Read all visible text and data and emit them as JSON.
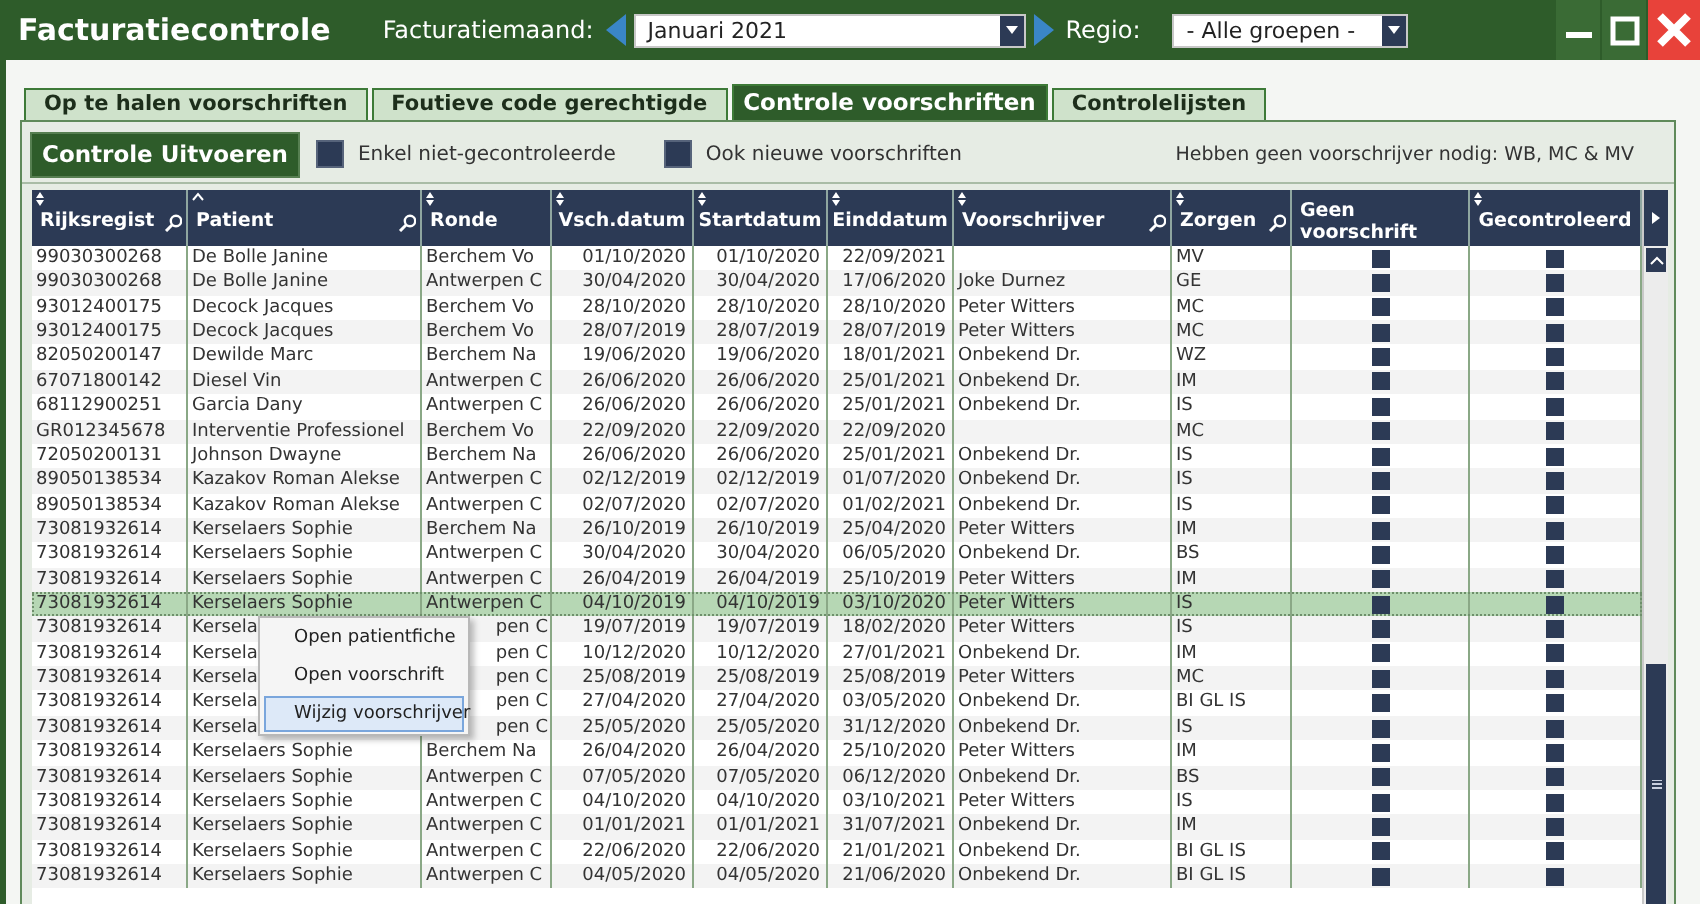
{
  "window": {
    "title": "Facturatiecontrole"
  },
  "filters": {
    "month_label": "Facturatiemaand:",
    "month": "Januari 2021",
    "region_label": "Regio:",
    "region": "- Alle groepen -"
  },
  "tabs": [
    {
      "label": "Op te halen voorschriften",
      "selected": false
    },
    {
      "label": "Foutieve code gerechtigde",
      "selected": false
    },
    {
      "label": "Controle voorschriften",
      "selected": true
    },
    {
      "label": "Controlelijsten",
      "selected": false
    }
  ],
  "toolbar": {
    "run_button": "Controle Uitvoeren",
    "options": [
      {
        "label": "Enkel niet-gecontroleerde",
        "checked": false
      },
      {
        "label": "Ook nieuwe voorschriften",
        "checked": false
      }
    ],
    "note": "Hebben geen voorschrijver nodig: WB, MC & MV"
  },
  "table": {
    "columns": [
      {
        "label": "Rijksregist",
        "kind": "text",
        "sortable": true,
        "sorted": false,
        "filter": true
      },
      {
        "label": "Patient",
        "kind": "text",
        "sortable": true,
        "sorted": true,
        "filter": true
      },
      {
        "label": "Ronde",
        "kind": "text",
        "sortable": true,
        "sorted": false,
        "filter": false
      },
      {
        "label": "Vsch.datum",
        "kind": "date",
        "sortable": true,
        "sorted": false,
        "filter": false
      },
      {
        "label": "Startdatum",
        "kind": "date",
        "sortable": true,
        "sorted": false,
        "filter": false
      },
      {
        "label": "Einddatum",
        "kind": "date",
        "sortable": true,
        "sorted": false,
        "filter": false
      },
      {
        "label": "Voorschrijver",
        "kind": "text",
        "sortable": true,
        "sorted": false,
        "filter": true
      },
      {
        "label": "Zorgen",
        "kind": "text",
        "sortable": true,
        "sorted": false,
        "filter": true
      },
      {
        "label": "Geen voorschrift",
        "kind": "check",
        "sortable": false,
        "filter": false
      },
      {
        "label": "Gecontroleerd",
        "kind": "check",
        "sortable": true,
        "sorted": false,
        "filter": false
      }
    ],
    "rows": [
      {
        "cells": [
          "99030300268",
          "De Bolle Janine",
          "Berchem Vo",
          "01/10/2020",
          "01/10/2020",
          "22/09/2021",
          null,
          "MV"
        ],
        "checks": [
          false,
          false
        ],
        "selected": false,
        "under_menu": false
      },
      {
        "cells": [
          "99030300268",
          "De Bolle Janine",
          "Antwerpen C",
          "30/04/2020",
          "30/04/2020",
          "17/06/2020",
          "Joke Durnez",
          "GE"
        ],
        "checks": [
          false,
          false
        ],
        "selected": false,
        "under_menu": false
      },
      {
        "cells": [
          "93012400175",
          "Decock Jacques",
          "Berchem Vo",
          "28/10/2020",
          "28/10/2020",
          "28/10/2020",
          "Peter Witters",
          "MC"
        ],
        "checks": [
          false,
          false
        ],
        "selected": false,
        "under_menu": false
      },
      {
        "cells": [
          "93012400175",
          "Decock Jacques",
          "Berchem Vo",
          "28/07/2019",
          "28/07/2019",
          "28/07/2019",
          "Peter Witters",
          "MC"
        ],
        "checks": [
          false,
          false
        ],
        "selected": false,
        "under_menu": false
      },
      {
        "cells": [
          "82050200147",
          "Dewilde Marc",
          "Berchem Na",
          "19/06/2020",
          "19/06/2020",
          "18/01/2021",
          "Onbekend Dr.",
          "WZ"
        ],
        "checks": [
          false,
          false
        ],
        "selected": false,
        "under_menu": false
      },
      {
        "cells": [
          "67071800142",
          "Diesel Vin",
          "Antwerpen C",
          "26/06/2020",
          "26/06/2020",
          "25/01/2021",
          "Onbekend Dr.",
          "IM"
        ],
        "checks": [
          false,
          false
        ],
        "selected": false,
        "under_menu": false
      },
      {
        "cells": [
          "68112900251",
          "Garcia Dany",
          "Antwerpen C",
          "26/06/2020",
          "26/06/2020",
          "25/01/2021",
          "Onbekend Dr.",
          "IS"
        ],
        "checks": [
          false,
          false
        ],
        "selected": false,
        "under_menu": false
      },
      {
        "cells": [
          "GR012345678",
          "Interventie Professionel",
          "Berchem Vo",
          "22/09/2020",
          "22/09/2020",
          "22/09/2020",
          null,
          "MC"
        ],
        "checks": [
          false,
          false
        ],
        "selected": false,
        "under_menu": false
      },
      {
        "cells": [
          "72050200131",
          "Johnson Dwayne",
          "Berchem Na",
          "26/06/2020",
          "26/06/2020",
          "25/01/2021",
          "Onbekend Dr.",
          "IS"
        ],
        "checks": [
          false,
          false
        ],
        "selected": false,
        "under_menu": false
      },
      {
        "cells": [
          "89050138534",
          "Kazakov Roman Alekse",
          "Antwerpen C",
          "02/12/2019",
          "02/12/2019",
          "01/07/2020",
          "Onbekend Dr.",
          "IS"
        ],
        "checks": [
          false,
          false
        ],
        "selected": false,
        "under_menu": false
      },
      {
        "cells": [
          "89050138534",
          "Kazakov Roman Alekse",
          "Antwerpen C",
          "02/07/2020",
          "02/07/2020",
          "01/02/2021",
          "Onbekend Dr.",
          "IS"
        ],
        "checks": [
          false,
          false
        ],
        "selected": false,
        "under_menu": false
      },
      {
        "cells": [
          "73081932614",
          "Kerselaers Sophie",
          "Berchem Na",
          "26/10/2019",
          "26/10/2019",
          "25/04/2020",
          "Peter Witters",
          "IM"
        ],
        "checks": [
          false,
          false
        ],
        "selected": false,
        "under_menu": false
      },
      {
        "cells": [
          "73081932614",
          "Kerselaers Sophie",
          "Antwerpen C",
          "30/04/2020",
          "30/04/2020",
          "06/05/2020",
          "Onbekend Dr.",
          "BS"
        ],
        "checks": [
          false,
          false
        ],
        "selected": false,
        "under_menu": false
      },
      {
        "cells": [
          "73081932614",
          "Kerselaers Sophie",
          "Antwerpen C",
          "26/04/2019",
          "26/04/2019",
          "25/10/2019",
          "Peter Witters",
          "IM"
        ],
        "checks": [
          false,
          false
        ],
        "selected": false,
        "under_menu": false
      },
      {
        "cells": [
          "73081932614",
          "Kerselaers Sophie",
          "Antwerpen C",
          "04/10/2019",
          "04/10/2019",
          "03/10/2020",
          "Peter Witters",
          "IS"
        ],
        "checks": [
          false,
          false
        ],
        "selected": true,
        "under_menu": false
      },
      {
        "cells": [
          "73081932614",
          "Kersela",
          "pen C",
          "19/07/2019",
          "19/07/2019",
          "18/02/2020",
          "Peter Witters",
          "IS"
        ],
        "checks": [
          false,
          false
        ],
        "selected": false,
        "under_menu": true
      },
      {
        "cells": [
          "73081932614",
          "Kersela",
          "pen C",
          "10/12/2020",
          "10/12/2020",
          "27/01/2021",
          "Onbekend Dr.",
          "IM"
        ],
        "checks": [
          false,
          false
        ],
        "selected": false,
        "under_menu": true
      },
      {
        "cells": [
          "73081932614",
          "Kersela",
          "pen C",
          "25/08/2019",
          "25/08/2019",
          "25/08/2019",
          "Peter Witters",
          "MC"
        ],
        "checks": [
          false,
          false
        ],
        "selected": false,
        "under_menu": true
      },
      {
        "cells": [
          "73081932614",
          "Kersela",
          "pen C",
          "27/04/2020",
          "27/04/2020",
          "03/05/2020",
          "Onbekend Dr.",
          "BI GL IS"
        ],
        "checks": [
          false,
          false
        ],
        "selected": false,
        "under_menu": true
      },
      {
        "cells": [
          "73081932614",
          "Kersela",
          "pen C",
          "25/05/2020",
          "25/05/2020",
          "31/12/2020",
          "Onbekend Dr.",
          "IS"
        ],
        "checks": [
          false,
          false
        ],
        "selected": false,
        "under_menu": true
      },
      {
        "cells": [
          "73081932614",
          "Kerselaers Sophie",
          "Berchem Na",
          "26/04/2020",
          "26/04/2020",
          "25/10/2020",
          "Peter Witters",
          "IM"
        ],
        "checks": [
          false,
          false
        ],
        "selected": false,
        "under_menu": false
      },
      {
        "cells": [
          "73081932614",
          "Kerselaers Sophie",
          "Antwerpen C",
          "07/05/2020",
          "07/05/2020",
          "06/12/2020",
          "Onbekend Dr.",
          "BS"
        ],
        "checks": [
          false,
          false
        ],
        "selected": false,
        "under_menu": false
      },
      {
        "cells": [
          "73081932614",
          "Kerselaers Sophie",
          "Antwerpen C",
          "04/10/2020",
          "04/10/2020",
          "03/10/2021",
          "Peter Witters",
          "IS"
        ],
        "checks": [
          false,
          false
        ],
        "selected": false,
        "under_menu": false
      },
      {
        "cells": [
          "73081932614",
          "Kerselaers Sophie",
          "Antwerpen C",
          "01/01/2021",
          "01/01/2021",
          "31/07/2021",
          "Onbekend Dr.",
          "IM"
        ],
        "checks": [
          false,
          false
        ],
        "selected": false,
        "under_menu": false
      },
      {
        "cells": [
          "73081932614",
          "Kerselaers Sophie",
          "Antwerpen C",
          "22/06/2020",
          "22/06/2020",
          "21/01/2021",
          "Onbekend Dr.",
          "BI GL IS"
        ],
        "checks": [
          false,
          false
        ],
        "selected": false,
        "under_menu": false
      },
      {
        "cells": [
          "73081932614",
          "Kerselaers Sophie",
          "Antwerpen C",
          "04/05/2020",
          "04/05/2020",
          "21/06/2020",
          "Onbekend Dr.",
          "BI GL IS"
        ],
        "checks": [
          false,
          false
        ],
        "selected": false,
        "under_menu": false
      }
    ]
  },
  "context_menu": {
    "items": [
      {
        "label": "Open patientfiche",
        "selected": false
      },
      {
        "label": "Open voorschrift",
        "selected": false
      },
      {
        "label": "Wijzig voorschrijver",
        "selected": true
      }
    ]
  }
}
